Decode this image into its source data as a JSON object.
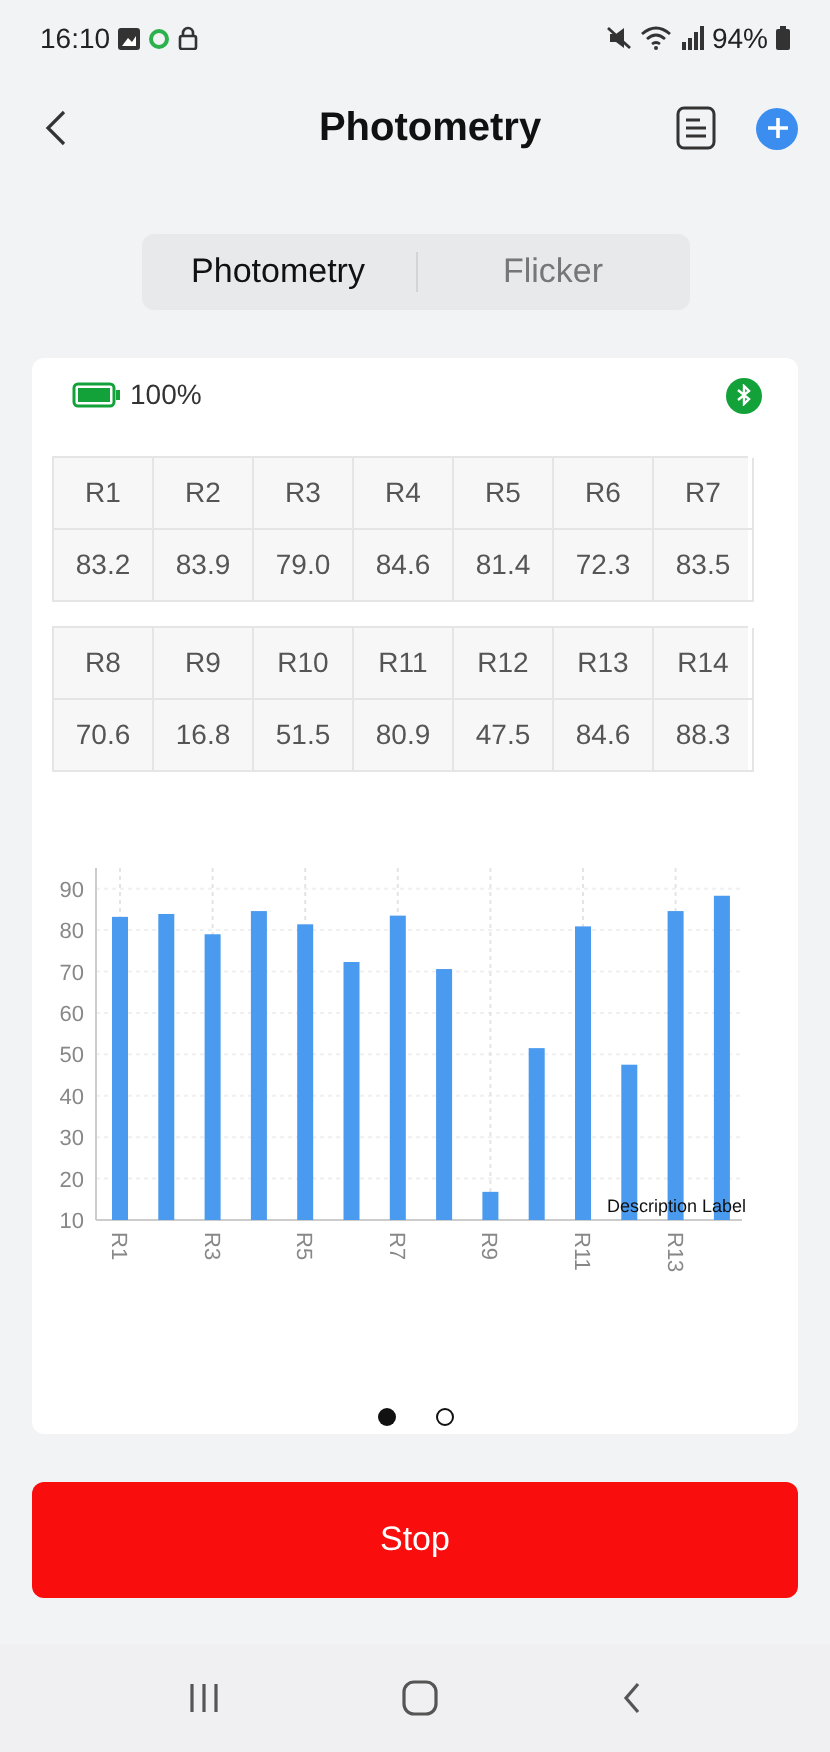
{
  "status_bar": {
    "time": "16:10",
    "battery": "94%"
  },
  "header": {
    "title": "Photometry"
  },
  "tabs": [
    {
      "label": "Photometry",
      "selected": true
    },
    {
      "label": "Flicker",
      "selected": false
    }
  ],
  "device": {
    "battery": "100%"
  },
  "tables": [
    {
      "headers": [
        "R1",
        "R2",
        "R3",
        "R4",
        "R5",
        "R6",
        "R7"
      ],
      "values": [
        "83.2",
        "83.9",
        "79.0",
        "84.6",
        "81.4",
        "72.3",
        "83.5"
      ]
    },
    {
      "headers": [
        "R8",
        "R9",
        "R10",
        "R11",
        "R12",
        "R13",
        "R14"
      ],
      "values": [
        "70.6",
        "16.8",
        "51.5",
        "80.9",
        "47.5",
        "84.6",
        "88.3"
      ]
    }
  ],
  "chart_data": {
    "type": "bar",
    "categories": [
      "R1",
      null,
      "R3",
      null,
      "R5",
      null,
      "R7",
      null,
      "R9",
      null,
      "R11",
      null,
      "R13",
      null
    ],
    "series": [
      {
        "color": "#4a9af0",
        "values": [
          83.2,
          83.9,
          79.0,
          84.6,
          81.4,
          72.3,
          83.5,
          70.6,
          16.8,
          51.5,
          80.9,
          47.5,
          84.6,
          88.3
        ]
      }
    ],
    "grid": true,
    "yticks": [
      10,
      20,
      30,
      40,
      50,
      60,
      70,
      80,
      90
    ],
    "ylim": [
      10,
      95
    ],
    "annotations": [
      "Description Label"
    ]
  },
  "pager": [
    {
      "selected": true
    },
    {
      "selected": false
    }
  ],
  "stop_button": {
    "label": "Stop"
  }
}
